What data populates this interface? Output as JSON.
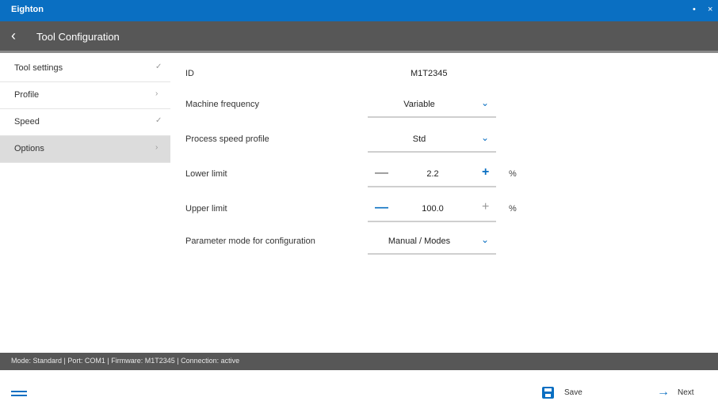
{
  "window": {
    "app_title": "Eighton",
    "icons": [
      "info-icon",
      "close-icon"
    ]
  },
  "header": {
    "back_icon": "‹",
    "title": "Tool Configuration"
  },
  "sidebar": {
    "items": [
      {
        "label": "Tool settings",
        "active": false
      },
      {
        "label": "Profile",
        "active": false
      },
      {
        "label": "Speed",
        "active": false
      },
      {
        "label": "Options",
        "active": true
      }
    ]
  },
  "form": {
    "id": {
      "label": "ID",
      "value": "M1T2345"
    },
    "machine_frequency": {
      "label": "Machine frequency",
      "value": "Variable"
    },
    "process_speed_profile": {
      "label": "Process speed profile",
      "value": "Std"
    },
    "lower_limit": {
      "label": "Lower limit",
      "value": "2.2",
      "unit": "%"
    },
    "upper_limit": {
      "label": "Upper limit",
      "value": "100.0",
      "unit": "%"
    },
    "parameter_mode": {
      "label": "Parameter mode for configuration",
      "value": "Manual / Modes"
    }
  },
  "status_bar": {
    "text": "Mode: Standard  |  Port: COM1  |  Firmware: M1T2345  |  Connection: active"
  },
  "bottom_bar": {
    "save_label": "Save",
    "next_label": "Next"
  },
  "colors": {
    "accent": "#0a6fc2",
    "header_bg": "#575757",
    "active_row": "#dcdcdc"
  }
}
